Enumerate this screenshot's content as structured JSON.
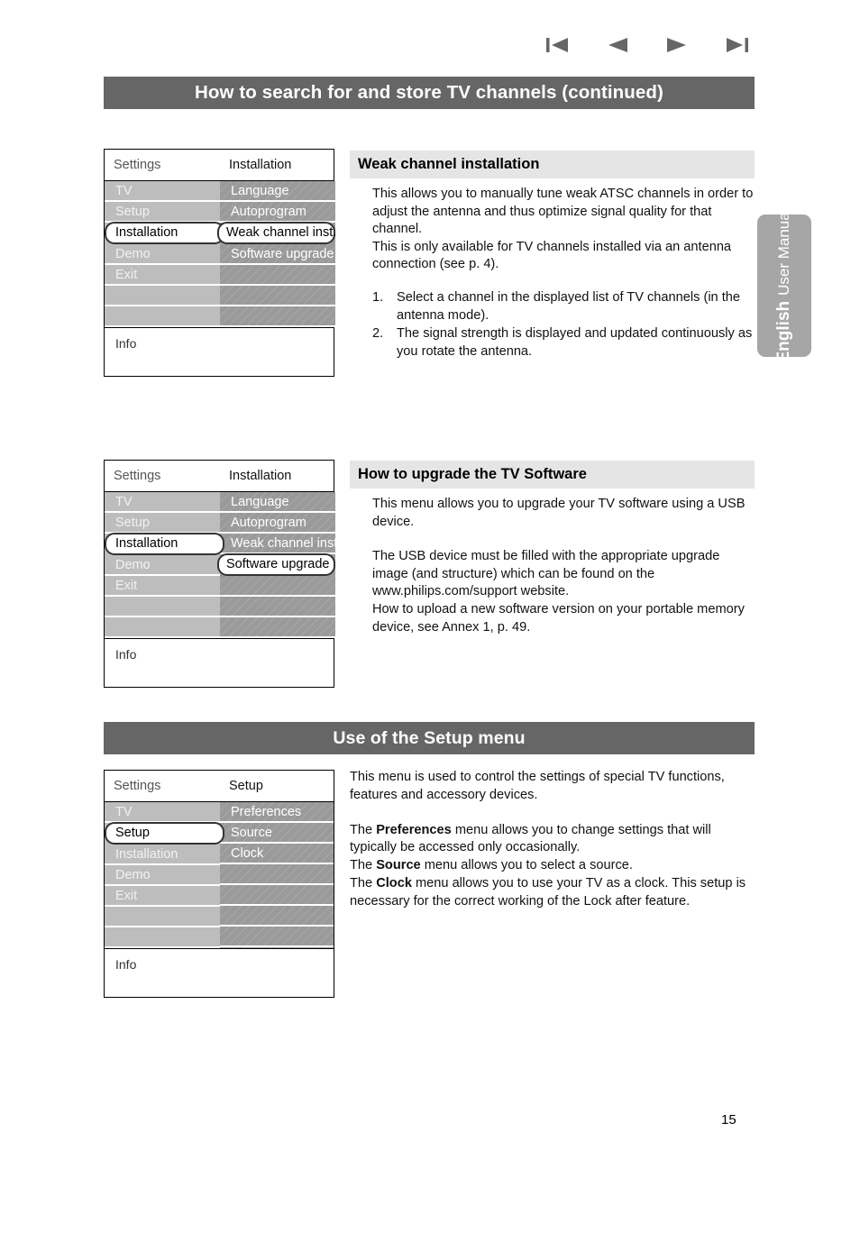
{
  "nav": {
    "first_icon": "skip-to-first-icon",
    "prev_icon": "previous-arrow-icon",
    "next_icon": "next-arrow-icon",
    "last_icon": "skip-to-last-icon"
  },
  "header": {
    "title": "How to search for and store TV channels (continued)"
  },
  "side_tab": {
    "language": "English",
    "subtitle": "User Manual"
  },
  "osd_labels": {
    "settings": "Settings",
    "info": "Info"
  },
  "menu1": {
    "panel_title": "Installation",
    "left_items": [
      "TV",
      "Setup",
      "Installation",
      "Demo",
      "Exit",
      "",
      ""
    ],
    "left_selected_index": 2,
    "right_items": [
      "Language",
      "Autoprogram",
      "Weak channel inst.",
      "Software upgrade",
      "",
      "",
      ""
    ],
    "right_selected_index": 2
  },
  "menu2": {
    "panel_title": "Installation",
    "left_items": [
      "TV",
      "Setup",
      "Installation",
      "Demo",
      "Exit",
      "",
      ""
    ],
    "left_selected_index": 2,
    "right_items": [
      "Language",
      "Autoprogram",
      "Weak channel inst.",
      "Software upgrade",
      "",
      "",
      ""
    ],
    "right_selected_index": 3
  },
  "menu3": {
    "panel_title": "Setup",
    "left_items": [
      "TV",
      "Setup",
      "Installation",
      "Demo",
      "Exit",
      "",
      ""
    ],
    "left_selected_index": 1,
    "right_items": [
      "Preferences",
      "Source",
      "Clock",
      "",
      "",
      "",
      ""
    ],
    "right_selected_index": -1
  },
  "section_weak": {
    "heading": "Weak channel installation",
    "para1": "This allows you to manually tune weak ATSC channels in order to adjust the antenna and thus optimize signal quality for that channel.",
    "para2": "This is only available for TV channels installed via an antenna connection (see p. 4).",
    "steps": [
      {
        "num": "1.",
        "text": "Select a channel in the displayed list of TV channels (in the antenna mode)."
      },
      {
        "num": "2.",
        "text": "The signal strength is displayed and updated continuously as you rotate the antenna."
      }
    ]
  },
  "section_software": {
    "heading": "How to upgrade the TV Software",
    "para1": "This menu allows you to upgrade your TV software using a USB device.",
    "para2": "The USB device must be filled with the appropriate upgrade image (and structure) which can be found on the www.philips.com/support website.",
    "para3": "How to upload a new software version on your portable memory device, see Annex 1, p. 49."
  },
  "section_setup": {
    "band_title": "Use of the Setup menu",
    "para1": "This menu is used to control the settings of special TV functions, features and accessory devices.",
    "line_pref_pre": "The ",
    "line_pref_bold": "Preferences",
    "line_pref_post": " menu allows you to change settings that will typically be accessed only occasionally.",
    "line_src_pre": "The ",
    "line_src_bold": "Source",
    "line_src_post": " menu allows you to select a source.",
    "line_clk_pre": "The ",
    "line_clk_bold": "Clock",
    "line_clk_post": " menu allows you to use your TV as a clock. This setup is necessary for the correct working of the Lock after feature."
  },
  "footer": {
    "page_number": "15"
  },
  "colors": {
    "band": "#666666",
    "section_heading_bg": "#e5e5e5",
    "osd_left": "#bdbdbd",
    "osd_right": "#9a9a9a",
    "tab": "#a6a6a6"
  }
}
